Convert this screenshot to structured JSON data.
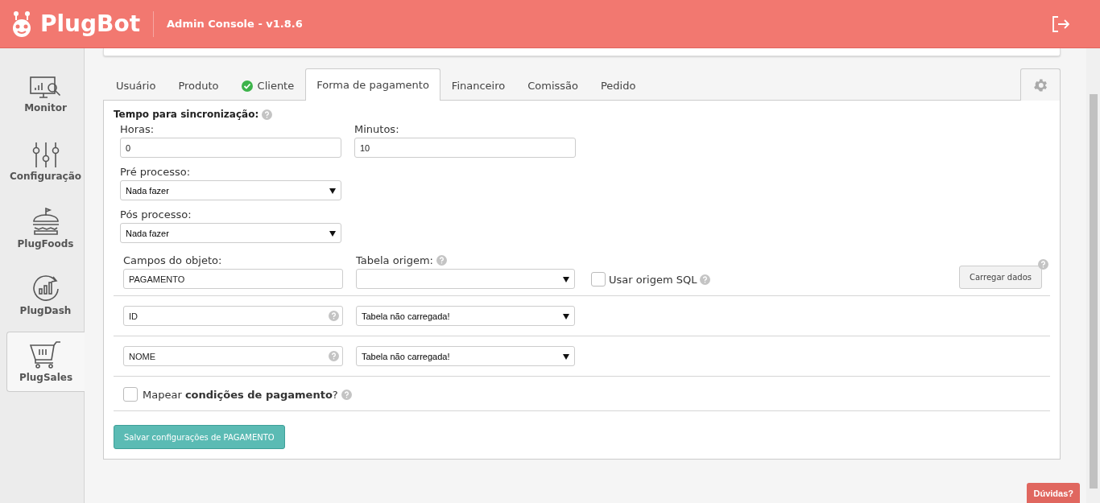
{
  "header": {
    "logo": "PlugBot",
    "subtitle": "Admin Console - v1.8.6"
  },
  "sidebar": {
    "items": [
      {
        "label": "Monitor",
        "selected": false
      },
      {
        "label": "Configuração",
        "selected": false
      },
      {
        "label": "PlugFoods",
        "selected": false
      },
      {
        "label": "PlugDash",
        "selected": false
      },
      {
        "label": "PlugSales",
        "selected": true
      }
    ]
  },
  "tabs": [
    {
      "label": "Usuário",
      "selected": false,
      "done": false
    },
    {
      "label": "Produto",
      "selected": false,
      "done": false
    },
    {
      "label": "Cliente",
      "selected": false,
      "done": true
    },
    {
      "label": "Forma de pagamento",
      "selected": true,
      "done": false
    },
    {
      "label": "Financeiro",
      "selected": false,
      "done": false
    },
    {
      "label": "Comissão",
      "selected": false,
      "done": false
    },
    {
      "label": "Pedido",
      "selected": false,
      "done": false
    }
  ],
  "form": {
    "sync_title": "Tempo para sincronização:",
    "hours": {
      "label": "Horas:",
      "value": "0"
    },
    "minutes": {
      "label": "Minutos:",
      "value": "10"
    },
    "pre_process": {
      "label": "Pré processo:",
      "value": "Nada fazer"
    },
    "post_process": {
      "label": "Pós processo:",
      "value": "Nada fazer"
    },
    "object_fields": {
      "label": "Campos do objeto:",
      "value": "PAGAMENTO"
    },
    "source_table": {
      "label": "Tabela origem:"
    },
    "use_sql": {
      "label": "Usar origem SQL",
      "checked": false
    },
    "load_button": "Carregar dados",
    "mappings": [
      {
        "field": "ID",
        "source": "Tabela não carregada!"
      },
      {
        "field": "NOME",
        "source": "Tabela não carregada!"
      }
    ],
    "map_conditions": {
      "label": "Mapear **condições de pagamento**?",
      "checked": false
    },
    "save_button": "Salvar configurações de PAGAMENTO"
  },
  "help_button": "Dúvidas?"
}
